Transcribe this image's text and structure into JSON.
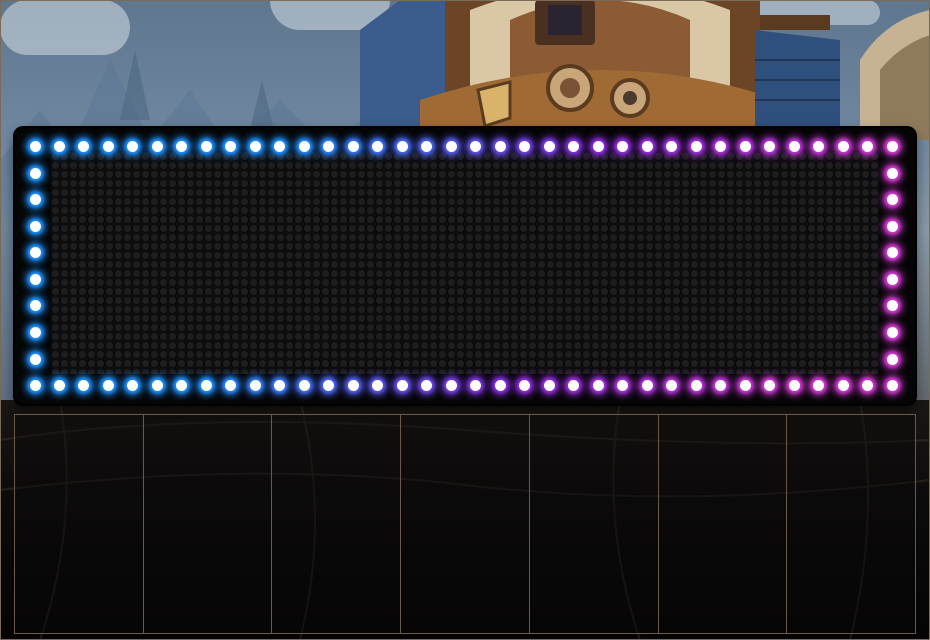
{
  "theme": {
    "bulb_core": "#ffffff",
    "bulb_glow_start": "#1e90ff",
    "bulb_glow_mid": "#8a2be2",
    "bulb_glow_end": "#d63ad6",
    "marquee_background": "#050505",
    "slot_border": "#6b5a4c"
  },
  "marquee": {
    "bulbs_top_row": 36,
    "bulbs_bottom_row": 36,
    "bulbs_side_column": 8
  },
  "slots": {
    "count": 7
  }
}
